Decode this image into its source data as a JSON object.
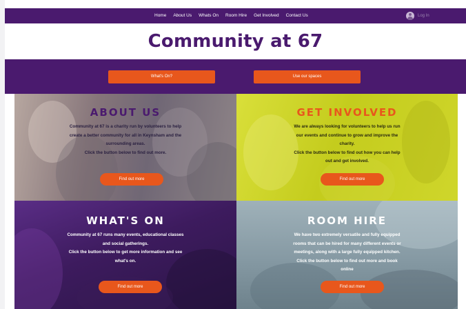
{
  "nav": {
    "links": [
      "Home",
      "About Us",
      "Whats On",
      "Room Hire",
      "Get Involved",
      "Contact Us"
    ],
    "login_label": "Log In"
  },
  "header": {
    "title": "Community at 67"
  },
  "band": {
    "whats_on_button": "What's On?",
    "spaces_button": "Use our spaces"
  },
  "tiles": [
    {
      "heading": "ABOUT US",
      "lines": [
        "Community at 67 is a charity run by volunteers to help",
        "create a better community for all in Keynsham and the",
        "surrounding areas.",
        "Click the button below to find out more."
      ],
      "button": "Find out more",
      "heading_color": "#4a1a6e",
      "text_color": "#2a2040"
    },
    {
      "heading": "GET INVOLVED",
      "lines": [
        "We are always looking for volunteers to help us run",
        "our events and continue to grow and improve the",
        "charity.",
        "Click the button below to find out how you can help",
        "out and get involved."
      ],
      "button": "Find out more",
      "heading_color": "#e8571c",
      "text_color": "#2a2a10"
    },
    {
      "heading": "WHAT'S ON",
      "lines": [
        "Community at 67 runs many events, educational classes",
        "and social gatherings.",
        "Click the button below to get more information and see",
        "what's on."
      ],
      "button": "Find out more",
      "heading_color": "#ffffff",
      "text_color": "#ffffff"
    },
    {
      "heading": "ROOM HIRE",
      "lines": [
        "We have two extremely versatile and fully equipped",
        "rooms that can be hired for many different events or",
        "meetings, along with a large fully equipped kitchen.",
        "Click the button below to find out more and book",
        "online"
      ],
      "button": "Find out more",
      "heading_color": "#ffffff",
      "text_color": "#ffffff"
    }
  ],
  "colors": {
    "brand_purple": "#4a1a6e",
    "accent_orange": "#e8571c",
    "involved_yellow": "#c7cf1e"
  }
}
